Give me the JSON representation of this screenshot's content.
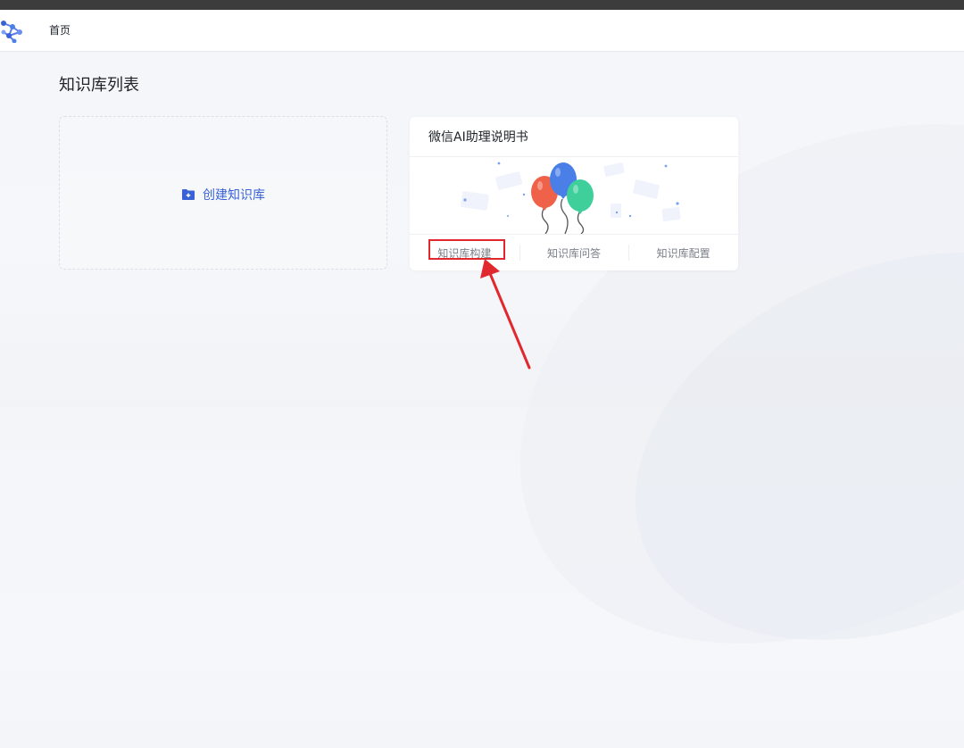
{
  "header": {
    "nav_home": "首页",
    "logo_icon": "network-nodes-logo"
  },
  "main": {
    "title": "知识库列表",
    "create_card": {
      "label": "创建知识库",
      "icon": "folder-plus-icon"
    },
    "knowledge_bases": [
      {
        "name": "微信AI助理说明书",
        "illustration": "balloons",
        "actions": [
          "知识库构建",
          "知识库问答",
          "知识库配置"
        ]
      }
    ]
  },
  "annotation": {
    "color": "#e0282e",
    "target": "知识库构建"
  },
  "colors": {
    "accent": "#3a62d7",
    "balloon_red": "#f0614a",
    "balloon_blue": "#4a7fe8",
    "balloon_green": "#3ecf9a"
  }
}
